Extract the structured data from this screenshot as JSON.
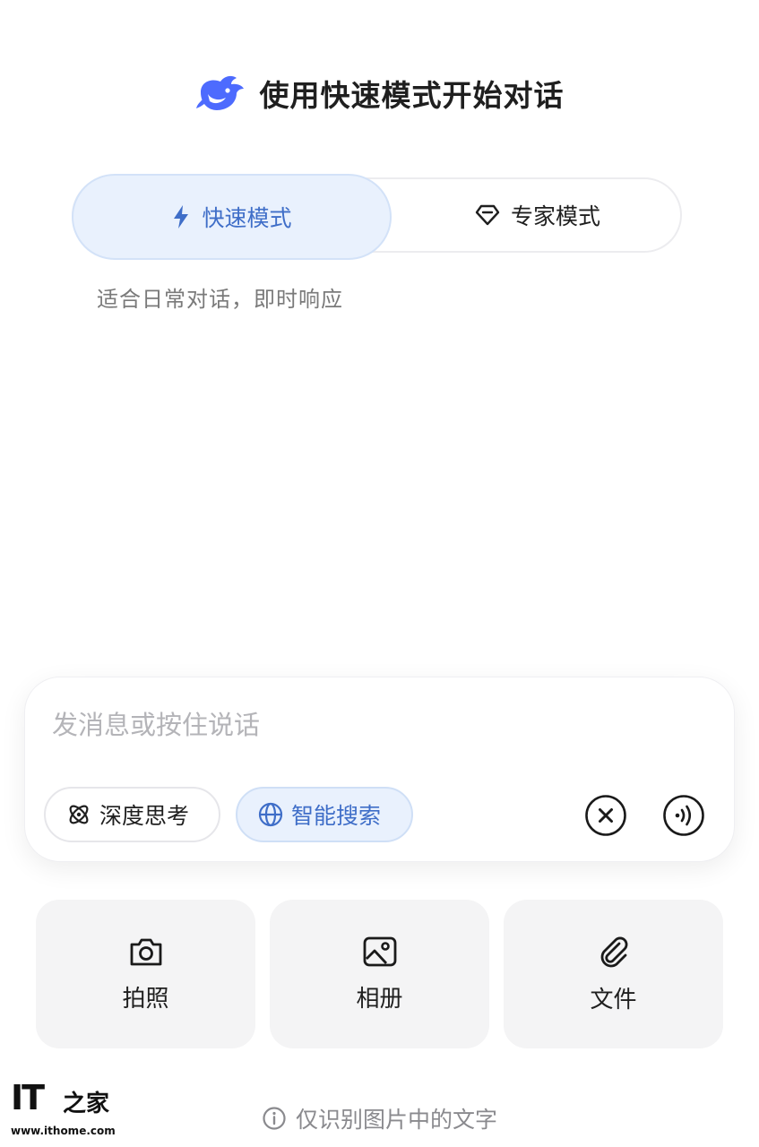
{
  "header": {
    "title": "使用快速模式开始对话",
    "logo_icon": "whale-logo-icon",
    "brand_color": "#4D6BFE"
  },
  "mode_switch": {
    "fast": {
      "label": "快速模式",
      "icon": "lightning-icon",
      "selected": true
    },
    "expert": {
      "label": "专家模式",
      "icon": "diamond-icon",
      "selected": false
    },
    "description": "适合日常对话，即时响应",
    "accent_color": "#3F6EC8"
  },
  "composer": {
    "placeholder": "发消息或按住说话",
    "value": "",
    "deep_think": {
      "label": "深度思考",
      "icon": "atom-icon",
      "active": false
    },
    "smart_search": {
      "label": "智能搜索",
      "icon": "globe-icon",
      "active": true
    },
    "close_icon": "close-circle-icon",
    "voice_icon": "voice-wave-icon"
  },
  "actions": [
    {
      "label": "拍照",
      "icon": "camera-icon"
    },
    {
      "label": "相册",
      "icon": "photo-album-icon"
    },
    {
      "label": "文件",
      "icon": "paperclip-icon"
    }
  ],
  "footer": {
    "note": "仅识别图片中的文字",
    "icon": "info-icon"
  },
  "watermark": {
    "brand": "IT",
    "glyph": "之家",
    "url": "www.ithome.com"
  }
}
